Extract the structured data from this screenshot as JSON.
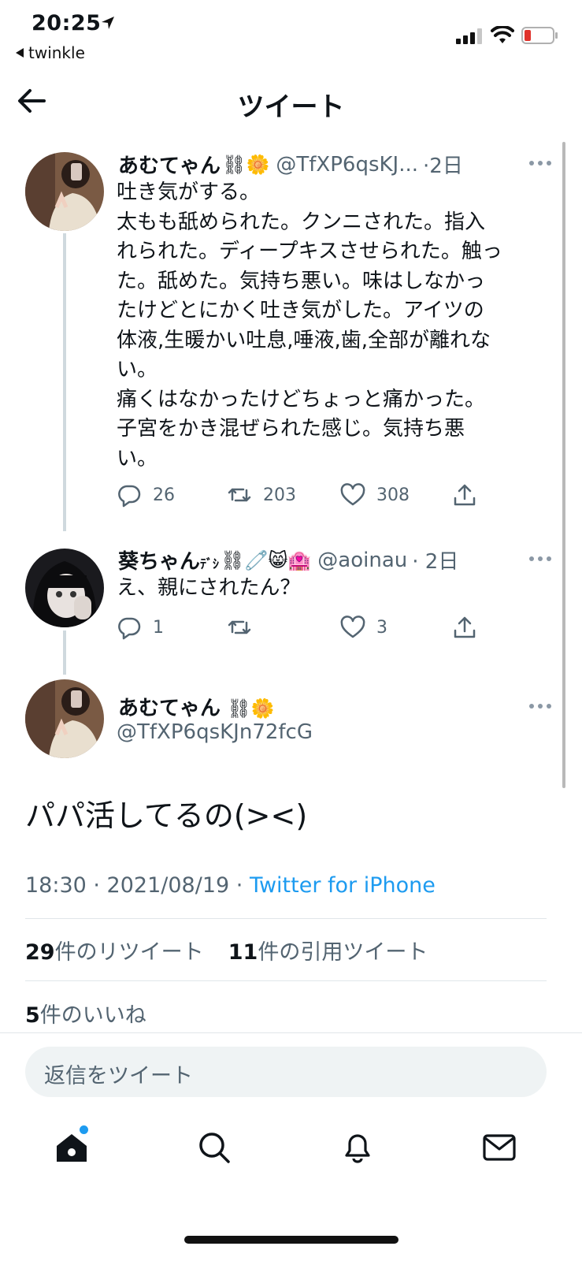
{
  "status_bar": {
    "time": "20:25",
    "back_app": "twinkle"
  },
  "header": {
    "title": "ツイート"
  },
  "thread": [
    {
      "name": "あむてゃん",
      "emojis": "⛓🌼",
      "handle": "@TfXP6qsKJ...",
      "time": "·2日",
      "text": "吐き気がする。\n太もも舐められた。クンニされた。指入\nれられた。ディープキスさせられた。触っ\nた。舐めた。気持ち悪い。味はしなかっ\nたけどとにかく吐き気がした。アイツの\n体液,生暖かい吐息,唾液,歯,全部が離れな\nい。\n痛くはなかったけどちょっと痛かった。\n子宮をかき混ぜられた感じ。気持ち悪\nい。",
      "replies": "26",
      "retweets": "203",
      "likes": "308"
    },
    {
      "name": "葵ちゃん",
      "name_suffix": "ﾃﾞｼ",
      "emojis": "⛓🧷😸🏩",
      "handle": "@aoinau",
      "time": "· 2日",
      "text": "え、親にされたん？",
      "replies": "1",
      "retweets": "",
      "likes": "3"
    }
  ],
  "main_tweet": {
    "name": "あむてゃん",
    "emojis": "⛓🌼",
    "handle": "@TfXP6qsKJn72fcG",
    "text": "パパ活してるの(><)",
    "timestamp": "18:30 · 2021/08/19 · ",
    "source": "Twitter for iPhone",
    "retweet_count": "29",
    "retweet_label": "件のリツイート",
    "quote_count": "11",
    "quote_label": "件の引用ツイート",
    "like_count": "5",
    "like_label": "件のいいね"
  },
  "reply_box": {
    "placeholder": "返信をツイート"
  },
  "colors": {
    "accent": "#1d9bf0",
    "text": "#0f1419",
    "muted": "#536471",
    "battery_low": "#e0322b"
  }
}
